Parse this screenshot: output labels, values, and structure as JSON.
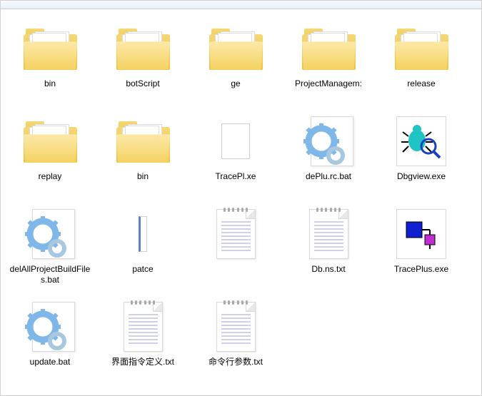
{
  "items": [
    {
      "label": "bin",
      "type": "folder"
    },
    {
      "label": "botScript",
      "type": "folder"
    },
    {
      "label": "ge",
      "type": "folder"
    },
    {
      "label": "ProjectManagem:",
      "type": "folder"
    },
    {
      "label": "release",
      "type": "folder"
    },
    {
      "label": "replay",
      "type": "folder"
    },
    {
      "label": "bin",
      "type": "folder"
    },
    {
      "label": "TracePl.xe",
      "type": "blank-small"
    },
    {
      "label": "dePlu.rc.bat",
      "type": "bat"
    },
    {
      "label": "Dbgview.exe",
      "type": "dbgview"
    },
    {
      "label": "delAllProjectBuildFiles.bat",
      "type": "bat"
    },
    {
      "label": "patce",
      "type": "blank-thin"
    },
    {
      "label": "",
      "type": "txt"
    },
    {
      "label": "Db.ns.txt",
      "type": "txt"
    },
    {
      "label": "TracePlus.exe",
      "type": "traceplus"
    },
    {
      "label": "update.bat",
      "type": "bat"
    },
    {
      "label": "界面指令定义.txt",
      "type": "txt"
    },
    {
      "label": "命令行参数.txt",
      "type": "txt"
    }
  ]
}
